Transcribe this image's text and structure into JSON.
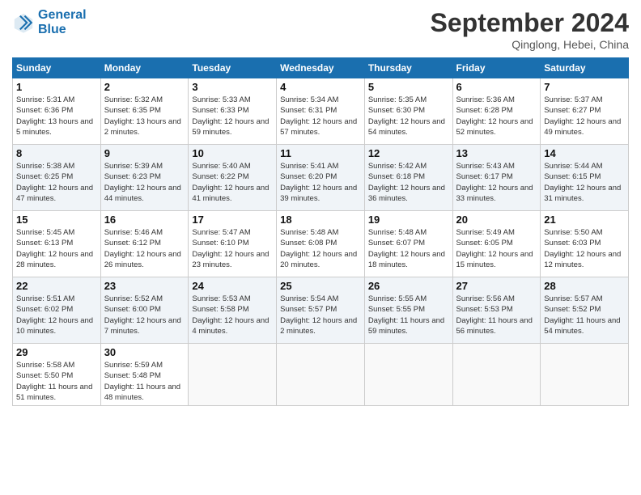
{
  "header": {
    "logo_line1": "General",
    "logo_line2": "Blue",
    "month": "September 2024",
    "location": "Qinglong, Hebei, China"
  },
  "weekdays": [
    "Sunday",
    "Monday",
    "Tuesday",
    "Wednesday",
    "Thursday",
    "Friday",
    "Saturday"
  ],
  "weeks": [
    [
      {
        "day": "1",
        "rise": "Sunrise: 5:31 AM",
        "set": "Sunset: 6:36 PM",
        "daylight": "Daylight: 13 hours and 5 minutes."
      },
      {
        "day": "2",
        "rise": "Sunrise: 5:32 AM",
        "set": "Sunset: 6:35 PM",
        "daylight": "Daylight: 13 hours and 2 minutes."
      },
      {
        "day": "3",
        "rise": "Sunrise: 5:33 AM",
        "set": "Sunset: 6:33 PM",
        "daylight": "Daylight: 12 hours and 59 minutes."
      },
      {
        "day": "4",
        "rise": "Sunrise: 5:34 AM",
        "set": "Sunset: 6:31 PM",
        "daylight": "Daylight: 12 hours and 57 minutes."
      },
      {
        "day": "5",
        "rise": "Sunrise: 5:35 AM",
        "set": "Sunset: 6:30 PM",
        "daylight": "Daylight: 12 hours and 54 minutes."
      },
      {
        "day": "6",
        "rise": "Sunrise: 5:36 AM",
        "set": "Sunset: 6:28 PM",
        "daylight": "Daylight: 12 hours and 52 minutes."
      },
      {
        "day": "7",
        "rise": "Sunrise: 5:37 AM",
        "set": "Sunset: 6:27 PM",
        "daylight": "Daylight: 12 hours and 49 minutes."
      }
    ],
    [
      {
        "day": "8",
        "rise": "Sunrise: 5:38 AM",
        "set": "Sunset: 6:25 PM",
        "daylight": "Daylight: 12 hours and 47 minutes."
      },
      {
        "day": "9",
        "rise": "Sunrise: 5:39 AM",
        "set": "Sunset: 6:23 PM",
        "daylight": "Daylight: 12 hours and 44 minutes."
      },
      {
        "day": "10",
        "rise": "Sunrise: 5:40 AM",
        "set": "Sunset: 6:22 PM",
        "daylight": "Daylight: 12 hours and 41 minutes."
      },
      {
        "day": "11",
        "rise": "Sunrise: 5:41 AM",
        "set": "Sunset: 6:20 PM",
        "daylight": "Daylight: 12 hours and 39 minutes."
      },
      {
        "day": "12",
        "rise": "Sunrise: 5:42 AM",
        "set": "Sunset: 6:18 PM",
        "daylight": "Daylight: 12 hours and 36 minutes."
      },
      {
        "day": "13",
        "rise": "Sunrise: 5:43 AM",
        "set": "Sunset: 6:17 PM",
        "daylight": "Daylight: 12 hours and 33 minutes."
      },
      {
        "day": "14",
        "rise": "Sunrise: 5:44 AM",
        "set": "Sunset: 6:15 PM",
        "daylight": "Daylight: 12 hours and 31 minutes."
      }
    ],
    [
      {
        "day": "15",
        "rise": "Sunrise: 5:45 AM",
        "set": "Sunset: 6:13 PM",
        "daylight": "Daylight: 12 hours and 28 minutes."
      },
      {
        "day": "16",
        "rise": "Sunrise: 5:46 AM",
        "set": "Sunset: 6:12 PM",
        "daylight": "Daylight: 12 hours and 26 minutes."
      },
      {
        "day": "17",
        "rise": "Sunrise: 5:47 AM",
        "set": "Sunset: 6:10 PM",
        "daylight": "Daylight: 12 hours and 23 minutes."
      },
      {
        "day": "18",
        "rise": "Sunrise: 5:48 AM",
        "set": "Sunset: 6:08 PM",
        "daylight": "Daylight: 12 hours and 20 minutes."
      },
      {
        "day": "19",
        "rise": "Sunrise: 5:48 AM",
        "set": "Sunset: 6:07 PM",
        "daylight": "Daylight: 12 hours and 18 minutes."
      },
      {
        "day": "20",
        "rise": "Sunrise: 5:49 AM",
        "set": "Sunset: 6:05 PM",
        "daylight": "Daylight: 12 hours and 15 minutes."
      },
      {
        "day": "21",
        "rise": "Sunrise: 5:50 AM",
        "set": "Sunset: 6:03 PM",
        "daylight": "Daylight: 12 hours and 12 minutes."
      }
    ],
    [
      {
        "day": "22",
        "rise": "Sunrise: 5:51 AM",
        "set": "Sunset: 6:02 PM",
        "daylight": "Daylight: 12 hours and 10 minutes."
      },
      {
        "day": "23",
        "rise": "Sunrise: 5:52 AM",
        "set": "Sunset: 6:00 PM",
        "daylight": "Daylight: 12 hours and 7 minutes."
      },
      {
        "day": "24",
        "rise": "Sunrise: 5:53 AM",
        "set": "Sunset: 5:58 PM",
        "daylight": "Daylight: 12 hours and 4 minutes."
      },
      {
        "day": "25",
        "rise": "Sunrise: 5:54 AM",
        "set": "Sunset: 5:57 PM",
        "daylight": "Daylight: 12 hours and 2 minutes."
      },
      {
        "day": "26",
        "rise": "Sunrise: 5:55 AM",
        "set": "Sunset: 5:55 PM",
        "daylight": "Daylight: 11 hours and 59 minutes."
      },
      {
        "day": "27",
        "rise": "Sunrise: 5:56 AM",
        "set": "Sunset: 5:53 PM",
        "daylight": "Daylight: 11 hours and 56 minutes."
      },
      {
        "day": "28",
        "rise": "Sunrise: 5:57 AM",
        "set": "Sunset: 5:52 PM",
        "daylight": "Daylight: 11 hours and 54 minutes."
      }
    ],
    [
      {
        "day": "29",
        "rise": "Sunrise: 5:58 AM",
        "set": "Sunset: 5:50 PM",
        "daylight": "Daylight: 11 hours and 51 minutes."
      },
      {
        "day": "30",
        "rise": "Sunrise: 5:59 AM",
        "set": "Sunset: 5:48 PM",
        "daylight": "Daylight: 11 hours and 48 minutes."
      },
      null,
      null,
      null,
      null,
      null
    ]
  ]
}
